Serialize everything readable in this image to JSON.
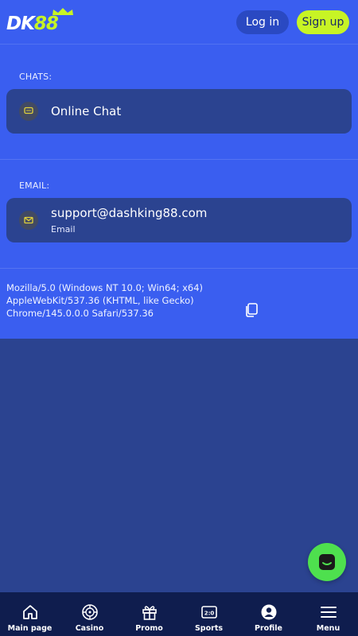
{
  "header": {
    "logo_text_dk": "DK",
    "logo_text_88": "88",
    "login_label": "Log in",
    "signup_label": "Sign up"
  },
  "chats": {
    "section_label": "CHATS:",
    "online_chat_label": "Online Chat",
    "icon": "chat-bubble-icon"
  },
  "email": {
    "section_label": "EMAIL:",
    "address": "support@dashking88.com",
    "sublabel": "Email",
    "icon": "envelope-icon"
  },
  "user_agent": {
    "text": "Mozilla/5.0 (Windows NT 10.0; Win64; x64) AppleWebKit/537.36 (KHTML, like Gecko) Chrome/145.0.0.0 Safari/537.36",
    "copy_icon": "copy-icon"
  },
  "bottom_nav": {
    "items": [
      {
        "label": "Main page",
        "icon": "home-icon"
      },
      {
        "label": "Casino",
        "icon": "roulette-icon"
      },
      {
        "label": "Promo",
        "icon": "gift-icon"
      },
      {
        "label": "Sports",
        "icon": "scoreboard-icon"
      },
      {
        "label": "Profile",
        "icon": "user-icon"
      },
      {
        "label": "Menu",
        "icon": "hamburger-icon"
      }
    ]
  },
  "chat_fab": {
    "icon": "chat-icon"
  },
  "colors": {
    "accent": "#c7f425",
    "primary_blue": "#3a5ef0",
    "dark_blue": "#2b4390",
    "nav_bg": "#0f1d4e",
    "fab_green": "#4ee04e"
  }
}
